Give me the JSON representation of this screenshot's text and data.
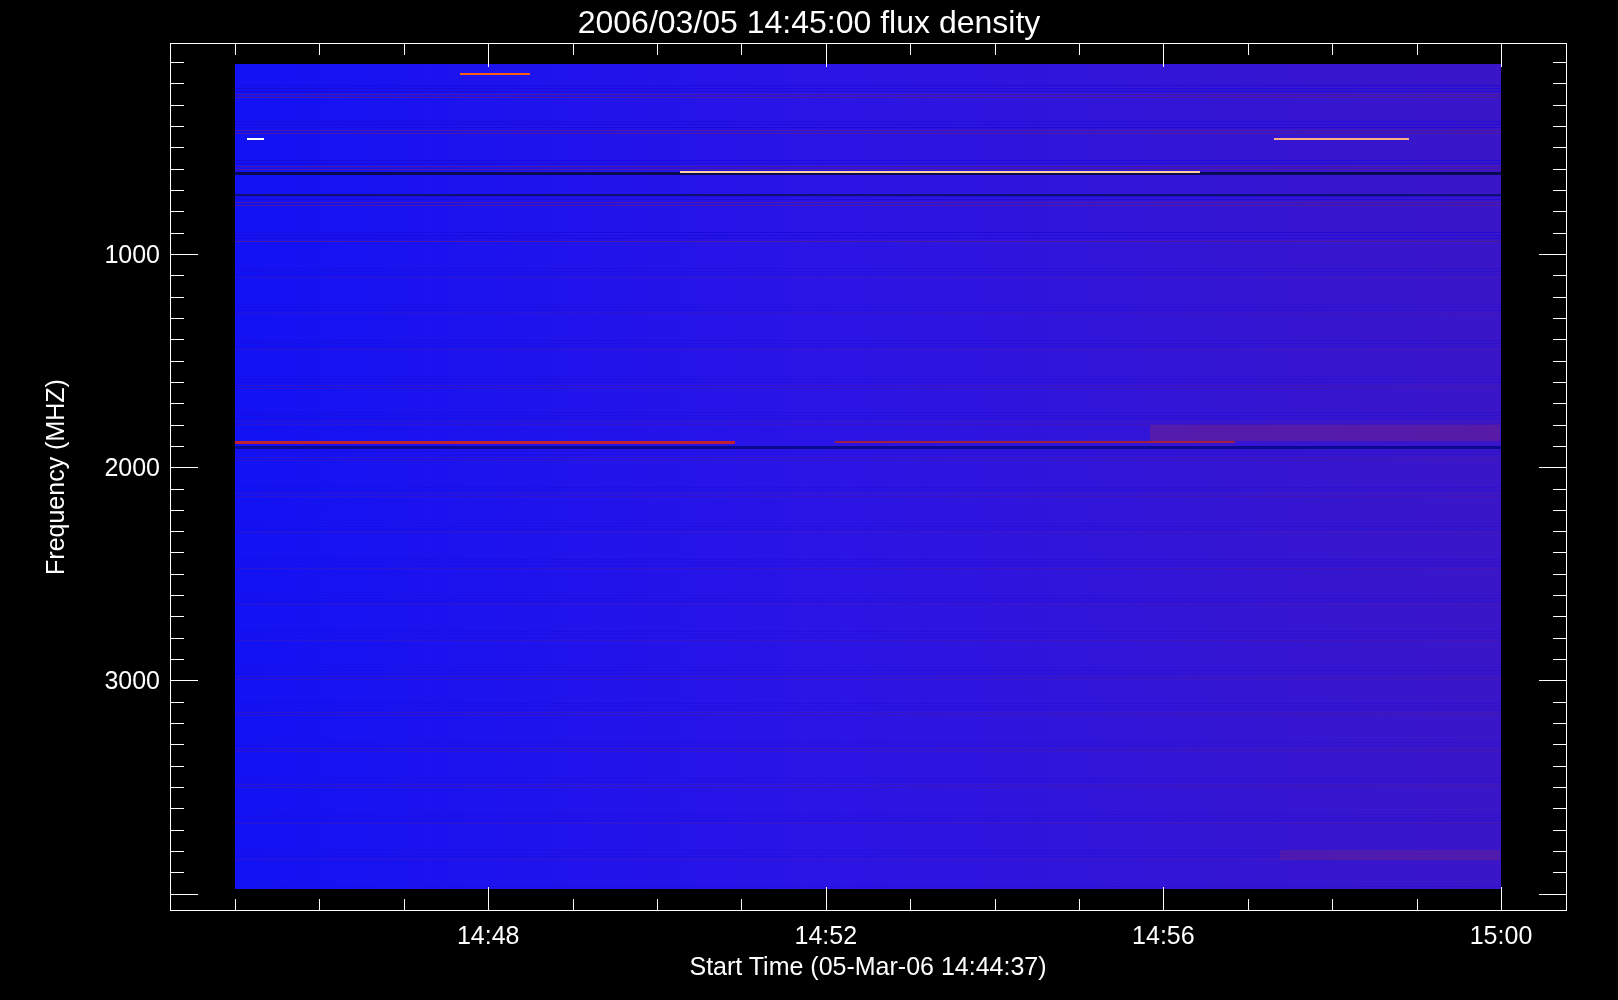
{
  "plot": {
    "title": "2006/03/05 14:45:00 flux density",
    "xlabel": "Start Time (05-Mar-06 14:44:37)",
    "ylabel": "Frequency (MHZ)",
    "xtick_labels": [
      "14:48",
      "14:52",
      "14:56",
      "15:00"
    ],
    "ytick_labels": [
      "1000",
      "2000",
      "3000"
    ]
  }
}
